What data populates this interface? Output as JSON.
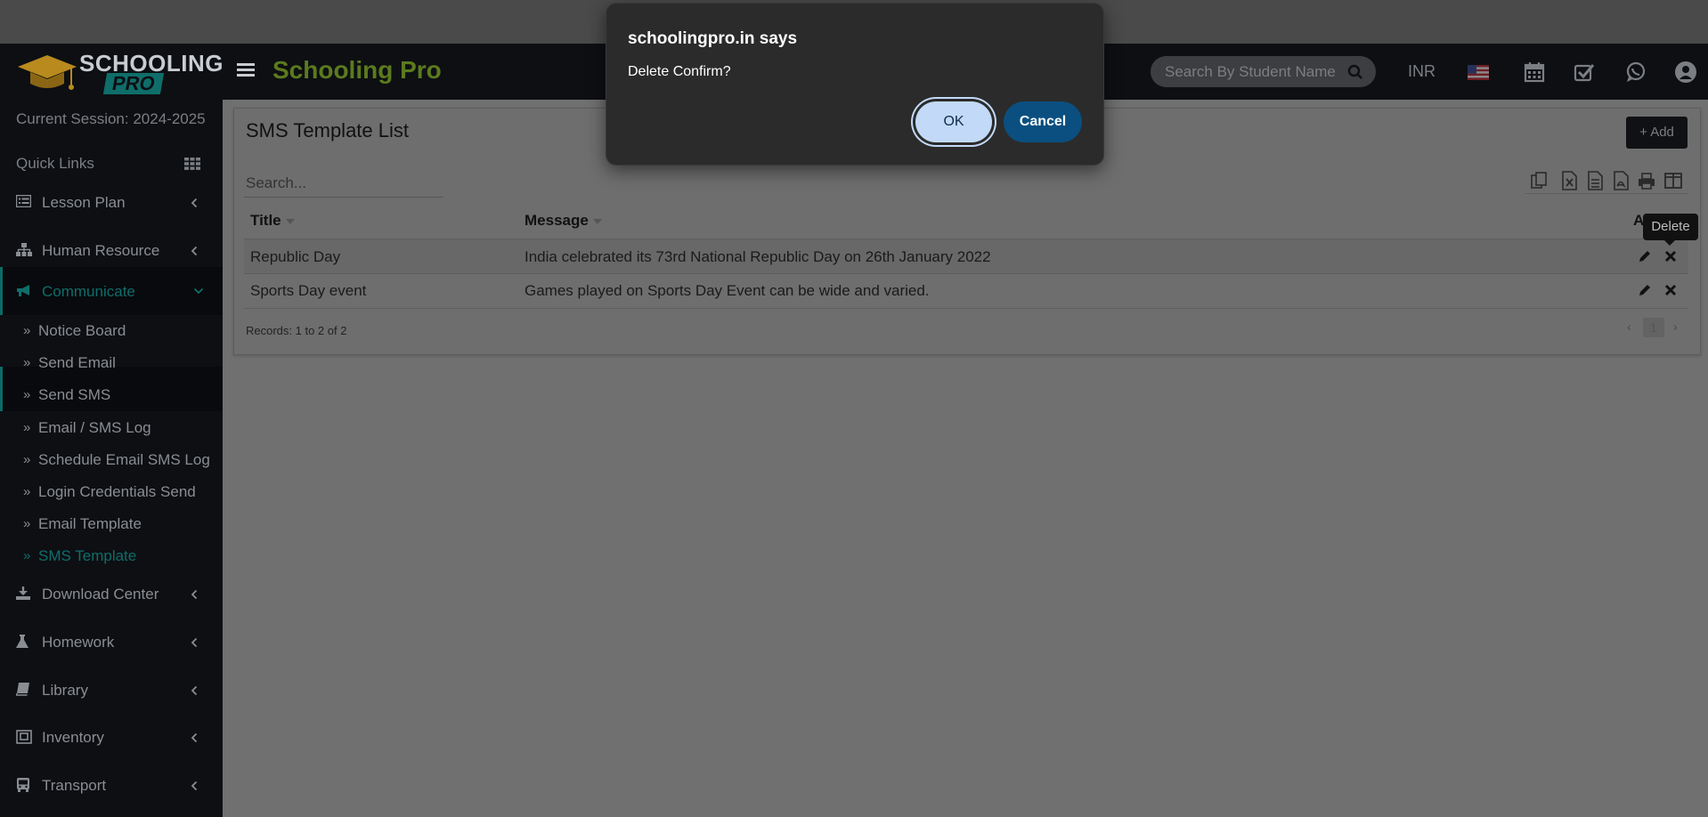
{
  "brand": {
    "logo_line1": "SCHOOLING",
    "logo_line2": "PRO",
    "title": "Schooling Pro"
  },
  "header": {
    "search_placeholder": "Search By Student Name",
    "currency": "INR"
  },
  "sidebar": {
    "session": "Current Session: 2024-2025",
    "quick_links": "Quick Links",
    "sections_top": [
      {
        "label": "Lesson Plan"
      },
      {
        "label": "Human Resource"
      },
      {
        "label": "Communicate"
      }
    ],
    "submenu": [
      {
        "label": "Notice Board"
      },
      {
        "label": "Send Email"
      },
      {
        "label": "Send SMS"
      },
      {
        "label": "Email / SMS Log"
      },
      {
        "label": "Schedule Email SMS Log"
      },
      {
        "label": "Login Credentials Send"
      },
      {
        "label": "Email Template"
      },
      {
        "label": "SMS Template"
      }
    ],
    "sections_bottom": [
      {
        "label": "Download Center"
      },
      {
        "label": "Homework"
      },
      {
        "label": "Library"
      },
      {
        "label": "Inventory"
      },
      {
        "label": "Transport"
      }
    ]
  },
  "main": {
    "title": "SMS Template List",
    "add_label": "+ Add",
    "search_placeholder": "Search...",
    "columns": {
      "title": "Title",
      "message": "Message",
      "action": "A"
    },
    "rows": [
      {
        "title": "Republic Day",
        "message": "India celebrated its 73rd National Republic Day on 26th January 2022"
      },
      {
        "title": "Sports Day event",
        "message": "Games played on Sports Day Event can be wide and varied."
      }
    ],
    "records": "Records: 1 to 2 of 2",
    "page": "1",
    "tooltip": "Delete"
  },
  "dialog": {
    "title": "schoolingpro.in says",
    "message": "Delete Confirm?",
    "ok": "OK",
    "cancel": "Cancel"
  },
  "colors": {
    "accent": "#0f6e6a",
    "brand": "#5c7a1e",
    "sidebar_bg": "#0d0f13",
    "ok_bg": "#c2daf7",
    "cancel_bg": "#0a4f80"
  }
}
